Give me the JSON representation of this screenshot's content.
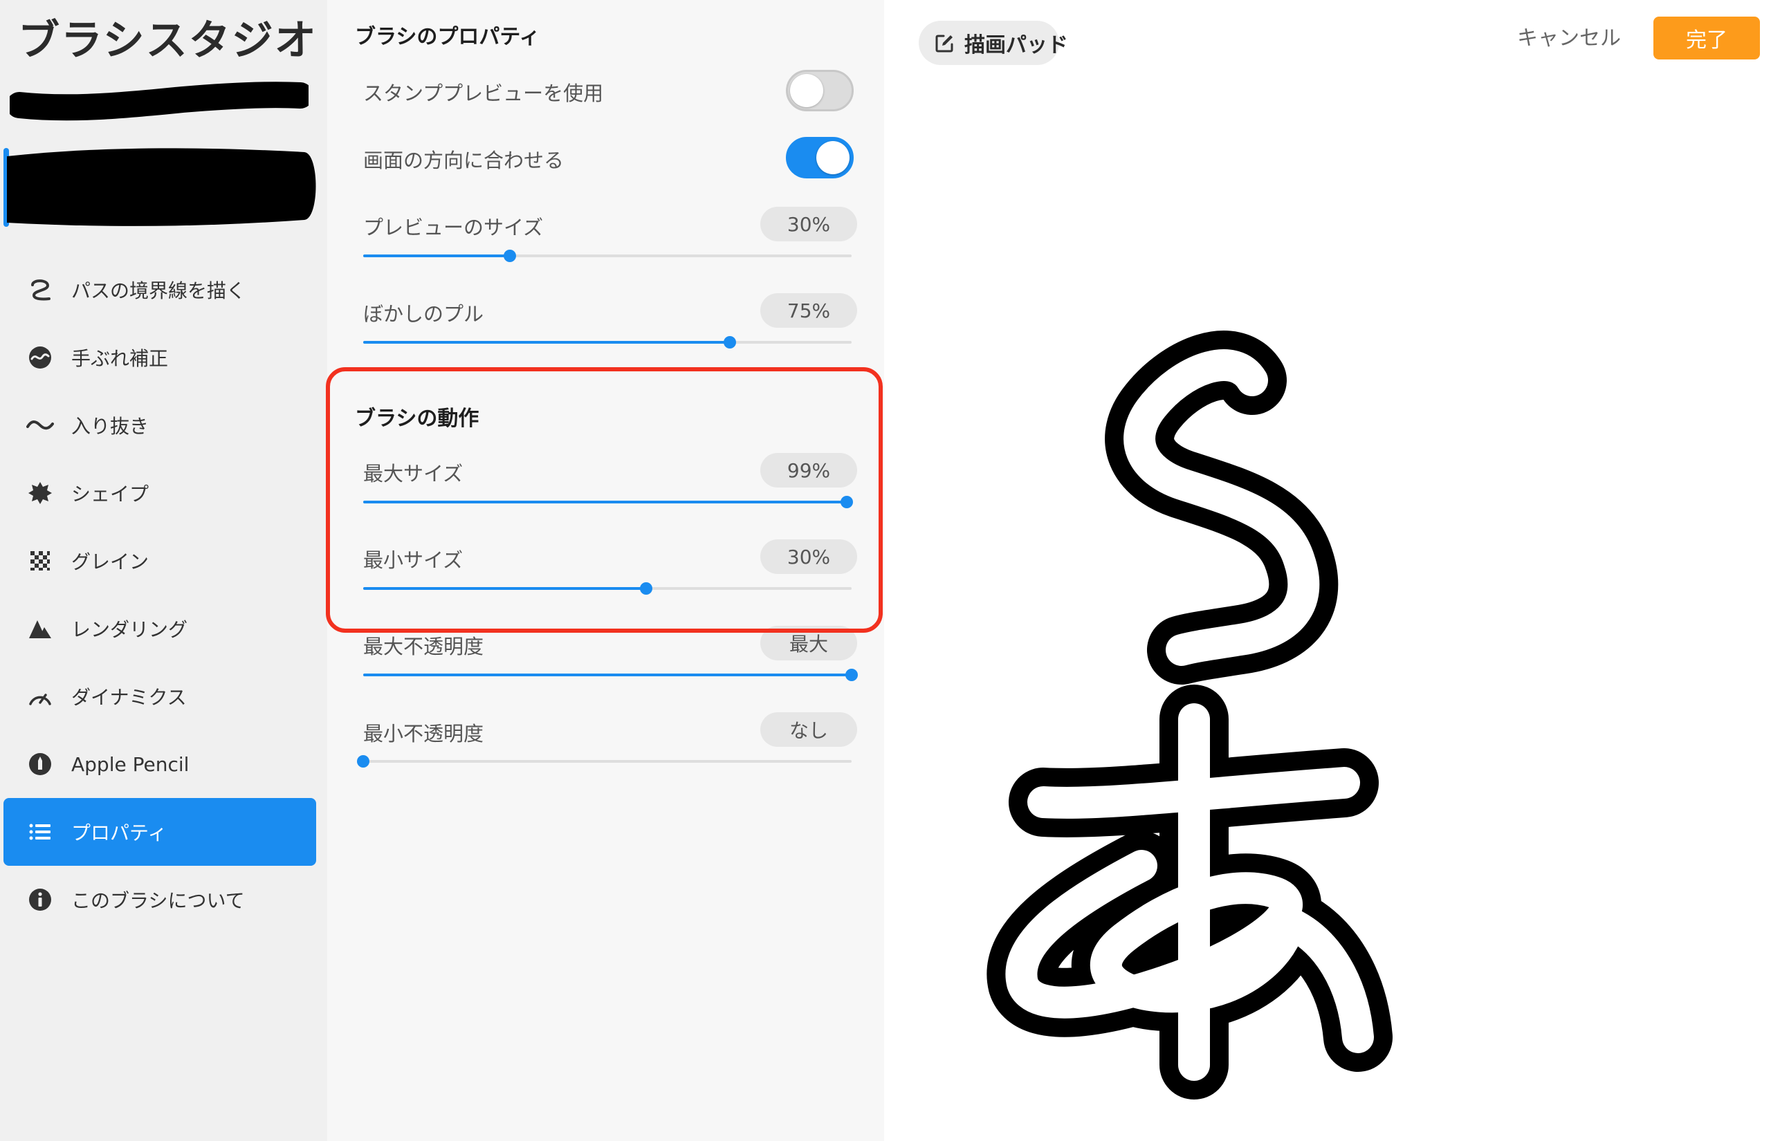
{
  "sidebar": {
    "title": "ブラシスタジオ",
    "items": [
      {
        "label": "パスの境界線を描く",
        "icon": "stroke-path-icon"
      },
      {
        "label": "手ぶれ補正",
        "icon": "stabilization-icon"
      },
      {
        "label": "入り抜き",
        "icon": "taper-icon"
      },
      {
        "label": "シェイプ",
        "icon": "shape-icon"
      },
      {
        "label": "グレイン",
        "icon": "grain-icon"
      },
      {
        "label": "レンダリング",
        "icon": "rendering-icon"
      },
      {
        "label": "ダイナミクス",
        "icon": "dynamics-icon"
      },
      {
        "label": "Apple Pencil",
        "icon": "apple-pencil-icon"
      },
      {
        "label": "プロパティ",
        "icon": "list-icon",
        "active": true
      },
      {
        "label": "このブラシについて",
        "icon": "info-icon"
      }
    ]
  },
  "properties": {
    "section_title": "ブラシのプロパティ",
    "stamp_preview": {
      "label": "スタンププレビューを使用",
      "on": false
    },
    "orient_to_screen": {
      "label": "画面の方向に合わせる",
      "on": true
    },
    "preview_size": {
      "label": "プレビューのサイズ",
      "value": "30%",
      "fraction": 0.3
    },
    "smudge_pull": {
      "label": "ぼかしのプル",
      "value": "75%",
      "fraction": 0.75
    }
  },
  "behavior": {
    "section_title": "ブラシの動作",
    "max_size": {
      "label": "最大サイズ",
      "value": "99%",
      "fraction": 0.99
    },
    "min_size": {
      "label": "最小サイズ",
      "value": "30%",
      "fraction": 0.58
    },
    "max_opacity": {
      "label": "最大不透明度",
      "value": "最大",
      "fraction": 1.0
    },
    "min_opacity": {
      "label": "最小不透明度",
      "value": "なし",
      "fraction": 0.0
    }
  },
  "pad": {
    "button_label": "描画パッド",
    "cancel_label": "キャンセル",
    "done_label": "完了"
  },
  "colors": {
    "accent": "#1a8cf0",
    "done": "#fd9b1b",
    "highlight": "#f2311f"
  }
}
